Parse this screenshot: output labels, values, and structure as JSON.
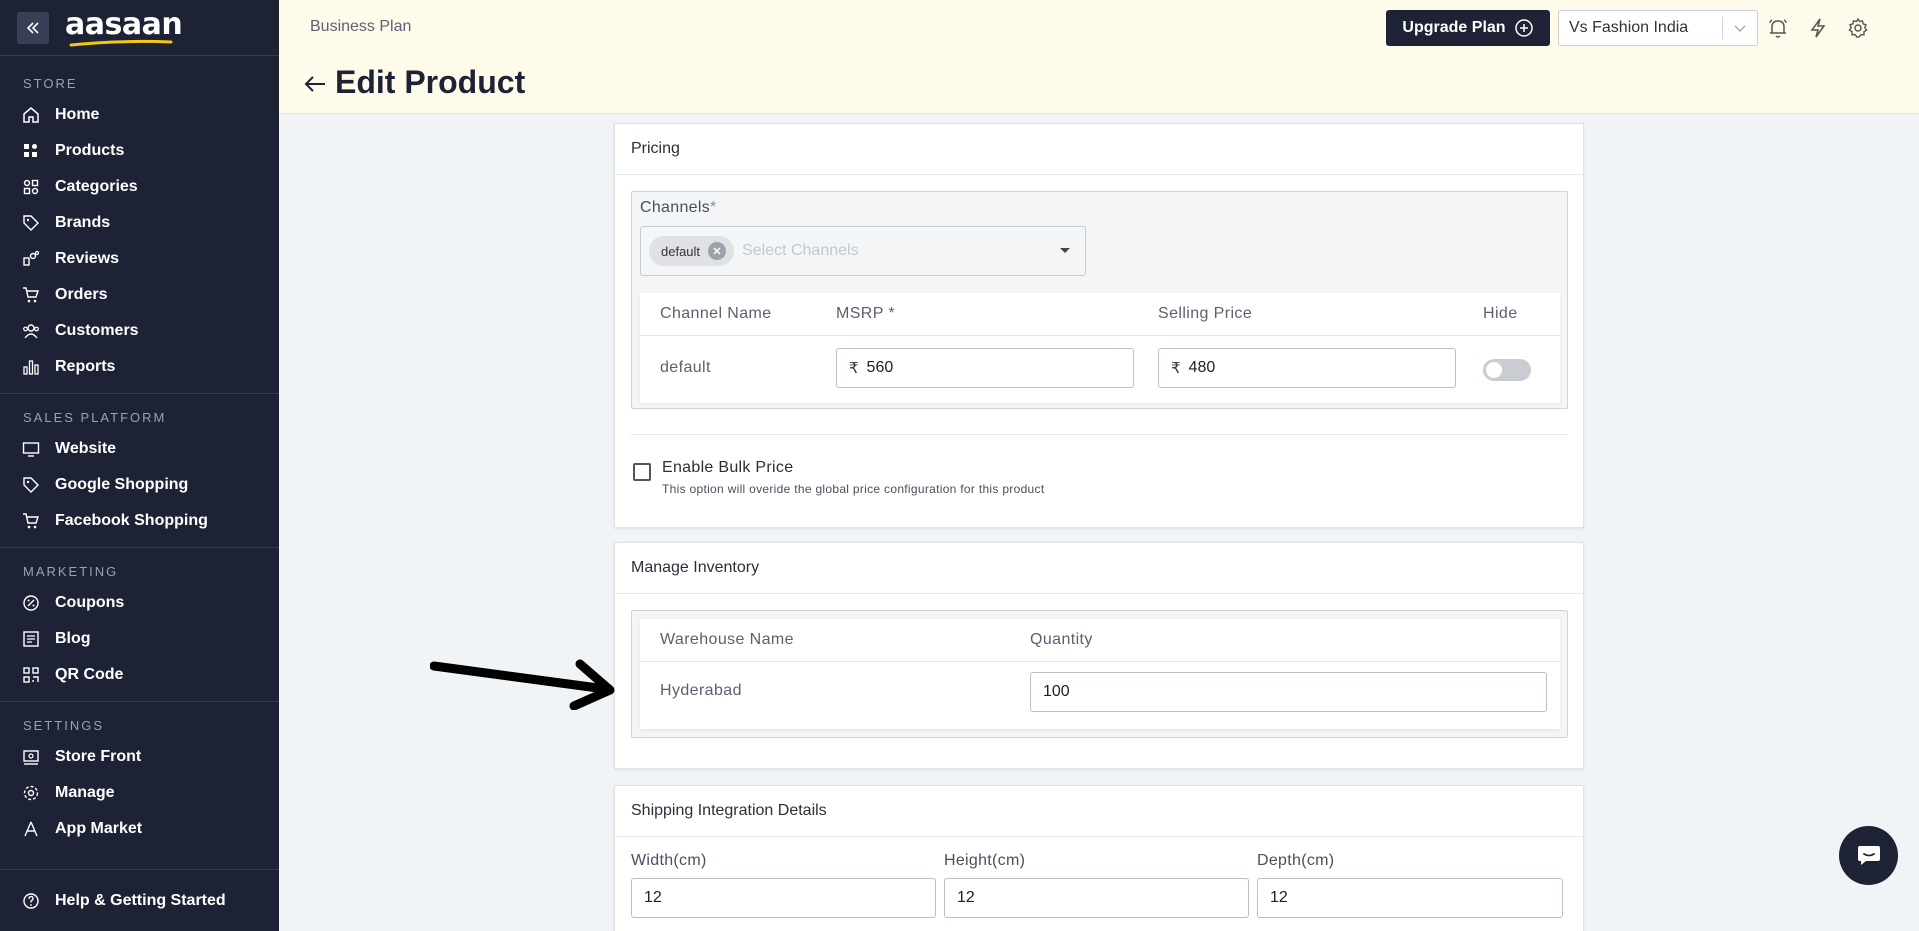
{
  "brand": {
    "logo_text": "aasaan"
  },
  "sidebar": {
    "sections": [
      {
        "title": "STORE",
        "items": [
          {
            "label": "Home",
            "icon": "home-icon"
          },
          {
            "label": "Products",
            "icon": "products-icon"
          },
          {
            "label": "Categories",
            "icon": "categories-icon"
          },
          {
            "label": "Brands",
            "icon": "tag-icon"
          },
          {
            "label": "Reviews",
            "icon": "reviews-icon"
          },
          {
            "label": "Orders",
            "icon": "cart-icon"
          },
          {
            "label": "Customers",
            "icon": "users-icon"
          },
          {
            "label": "Reports",
            "icon": "bar-chart-icon"
          }
        ]
      },
      {
        "title": "SALES PLATFORM",
        "items": [
          {
            "label": "Website",
            "icon": "monitor-icon"
          },
          {
            "label": "Google Shopping",
            "icon": "tag-icon"
          },
          {
            "label": "Facebook Shopping",
            "icon": "cart-icon"
          }
        ]
      },
      {
        "title": "MARKETING",
        "items": [
          {
            "label": "Coupons",
            "icon": "coupon-icon"
          },
          {
            "label": "Blog",
            "icon": "blog-icon"
          },
          {
            "label": "QR Code",
            "icon": "qr-code-icon"
          }
        ]
      },
      {
        "title": "SETTINGS",
        "items": [
          {
            "label": "Store Front",
            "icon": "store-front-icon"
          },
          {
            "label": "Manage",
            "icon": "gear-icon"
          },
          {
            "label": "App Market",
            "icon": "app-market-icon"
          }
        ]
      }
    ],
    "help": {
      "label": "Help & Getting Started",
      "icon": "help-icon"
    }
  },
  "header": {
    "plan": "Business Plan",
    "title": "Edit Product",
    "upgrade_label": "Upgrade Plan",
    "store_name": "Vs Fashion India"
  },
  "pricing": {
    "heading": "Pricing",
    "channels_label": "Channels",
    "required_mark": "*",
    "selected_chip": "default",
    "channels_placeholder": "Select Channels",
    "columns": [
      "Channel Name",
      "MSRP *",
      "Selling Price",
      "Hide"
    ],
    "rows": [
      {
        "channel": "default",
        "currency": "₹",
        "msrp": "560",
        "selling_price": "480",
        "hidden": false
      }
    ],
    "bulk_label": "Enable Bulk Price",
    "bulk_help": "This option will overide the global price configuration for this product"
  },
  "inventory": {
    "heading": "Manage Inventory",
    "columns": [
      "Warehouse Name",
      "Quantity"
    ],
    "rows": [
      {
        "warehouse": "Hyderabad",
        "quantity": "100"
      }
    ]
  },
  "shipping": {
    "heading": "Shipping Integration Details",
    "width_label": "Width(cm)",
    "width": "12",
    "height_label": "Height(cm)",
    "height": "12",
    "depth_label": "Depth(cm)",
    "depth": "12"
  },
  "colors": {
    "sidebar_bg": "#1e2235",
    "header_bg": "#fefbea",
    "logo_accent": "#f5c518"
  }
}
